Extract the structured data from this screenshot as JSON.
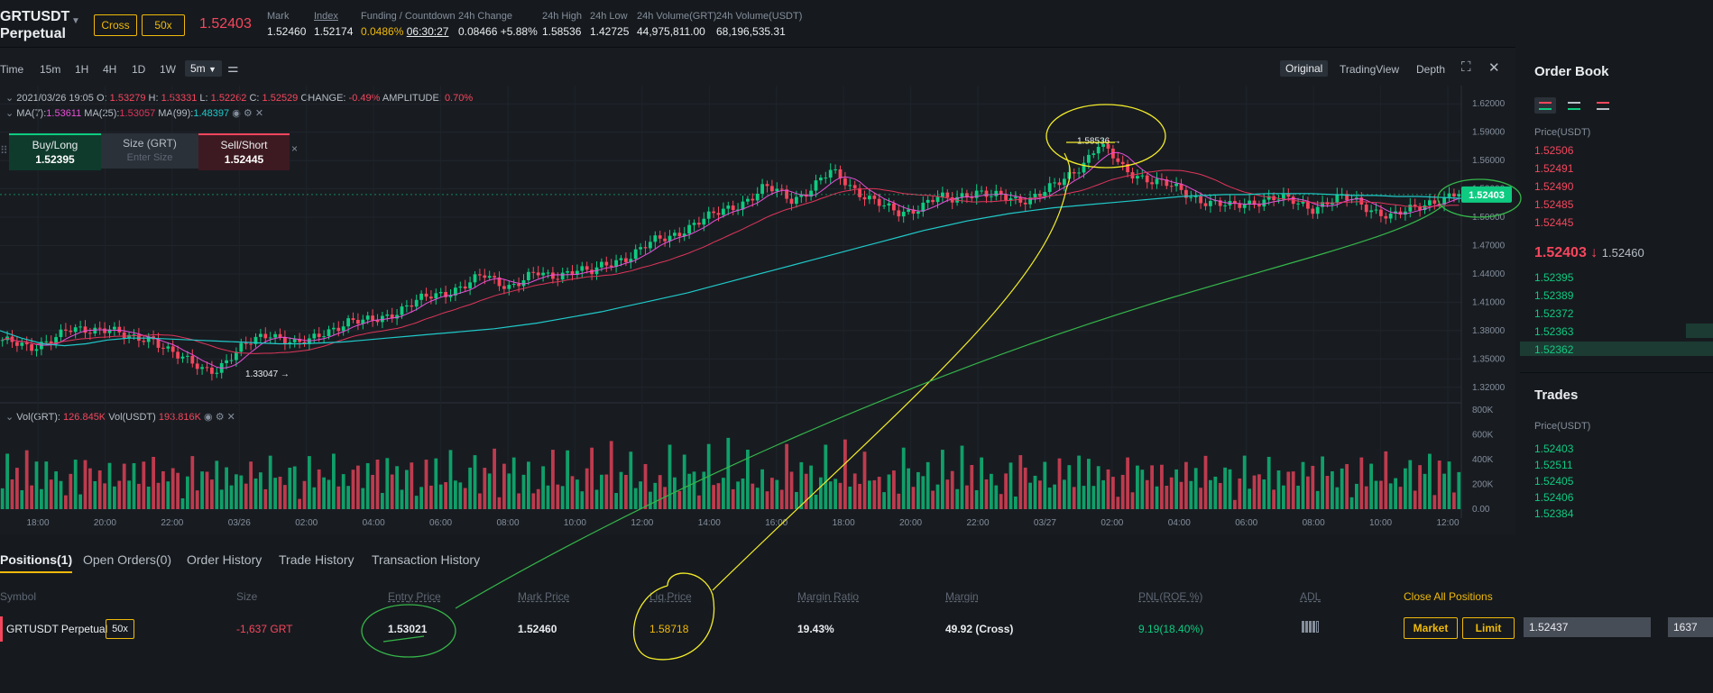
{
  "header": {
    "symbol_line1": "GRTUSDT",
    "symbol_line2": "Perpetual",
    "margin_mode": "Cross",
    "leverage": "50x",
    "last_price": "1.52403",
    "stats": [
      {
        "label": "Mark",
        "value": "1.52460"
      },
      {
        "label": "Index",
        "value": "1.52174"
      },
      {
        "label": "Funding / Countdown",
        "value_a": "0.0486%",
        "value_b": "06:30:27"
      },
      {
        "label": "24h Change",
        "value": "0.08466 +5.88%"
      },
      {
        "label": "24h High",
        "value": "1.58536"
      },
      {
        "label": "24h Low",
        "value": "1.42725"
      },
      {
        "label": "24h Volume(GRT)",
        "value": "44,975,811.00"
      },
      {
        "label": "24h Volume(USDT)",
        "value": "68,196,535.31"
      }
    ]
  },
  "toolbar": {
    "intervals": [
      "Time",
      "15m",
      "1H",
      "4H",
      "1D",
      "1W"
    ],
    "active_interval": "5m",
    "views": [
      "Original",
      "TradingView",
      "Depth"
    ],
    "active_view": "Original"
  },
  "legend": {
    "ohlc_date": "2021/03/26 19:05",
    "o_label": "O:",
    "o": "1.53279",
    "h_label": "H:",
    "h": "1.53331",
    "l_label": "L:",
    "l": "1.52262",
    "c_label": "C:",
    "c": "1.52529",
    "change_label": "CHANGE:",
    "change": "-0.49%",
    "amplitude_label": "AMPLITUDE:",
    "amplitude": "0.70%",
    "ma7_label": "MA(7):",
    "ma7": "1.53611",
    "ma25_label": "MA(25):",
    "ma25": "1.53057",
    "ma99_label": "MA(99):",
    "ma99": "1.48397",
    "vol_grt_label": "Vol(GRT):",
    "vol_grt": "126.845K",
    "vol_usdt_label": "Vol(USDT)",
    "vol_usdt": "193.816K"
  },
  "trade_widget": {
    "buy_label": "Buy/Long",
    "buy_price": "1.52395",
    "size_label": "Size (GRT)",
    "size_placeholder": "Enter Size",
    "sell_label": "Sell/Short",
    "sell_price": "1.52445",
    "close": "×"
  },
  "chart_data": {
    "type": "candlestick",
    "y_ticks": [
      "1.62000",
      "1.59000",
      "1.56000",
      "1.53000",
      "1.50000",
      "1.47000",
      "1.44000",
      "1.41000",
      "1.38000",
      "1.35000",
      "1.32000"
    ],
    "vol_ticks": [
      "800K",
      "600K",
      "400K",
      "200K",
      "0.00"
    ],
    "x_ticks": [
      "18:00",
      "20:00",
      "22:00",
      "03/26",
      "02:00",
      "04:00",
      "06:00",
      "08:00",
      "10:00",
      "12:00",
      "14:00",
      "16:00",
      "18:00",
      "20:00",
      "22:00",
      "03/27",
      "02:00",
      "04:00",
      "06:00",
      "08:00",
      "10:00",
      "12:00"
    ],
    "y_range": [
      1.315,
      1.625
    ],
    "high_label": "1.58536",
    "low_label": "1.33047",
    "current_price_tag": "1.52403",
    "close_path": [
      1.37,
      1.365,
      1.36,
      1.368,
      1.375,
      1.38,
      1.378,
      1.382,
      1.385,
      1.375,
      1.368,
      1.372,
      1.366,
      1.355,
      1.345,
      1.338,
      1.34,
      1.352,
      1.362,
      1.37,
      1.378,
      1.373,
      1.365,
      1.368,
      1.378,
      1.385,
      1.39,
      1.388,
      1.392,
      1.398,
      1.404,
      1.41,
      1.416,
      1.42,
      1.425,
      1.43,
      1.438,
      1.432,
      1.428,
      1.434,
      1.44,
      1.436,
      1.442,
      1.446,
      1.44,
      1.448,
      1.455,
      1.46,
      1.468,
      1.475,
      1.48,
      1.488,
      1.494,
      1.5,
      1.508,
      1.514,
      1.52,
      1.53,
      1.528,
      1.52,
      1.525,
      1.535,
      1.548,
      1.54,
      1.528,
      1.518,
      1.51,
      1.505,
      1.508,
      1.514,
      1.52,
      1.518,
      1.525,
      1.528,
      1.522,
      1.52,
      1.518,
      1.522,
      1.528,
      1.534,
      1.545,
      1.56,
      1.578,
      1.565,
      1.548,
      1.545,
      1.54,
      1.535,
      1.528,
      1.522,
      1.518,
      1.514,
      1.51,
      1.514,
      1.518,
      1.521,
      1.518,
      1.514,
      1.51,
      1.516,
      1.52,
      1.518,
      1.512,
      1.506,
      1.5,
      1.505,
      1.512,
      1.518,
      1.52,
      1.524
    ],
    "ma99_path": [
      1.38,
      1.372,
      1.366,
      1.364,
      1.366,
      1.37,
      1.372,
      1.372,
      1.371,
      1.37,
      1.369,
      1.368,
      1.367,
      1.366,
      1.366,
      1.367,
      1.368,
      1.37,
      1.372,
      1.374,
      1.376,
      1.378,
      1.38,
      1.382,
      1.385,
      1.388,
      1.392,
      1.396,
      1.4,
      1.405,
      1.41,
      1.415,
      1.42,
      1.426,
      1.432,
      1.438,
      1.444,
      1.45,
      1.456,
      1.462,
      1.468,
      1.474,
      1.48,
      1.486,
      1.491,
      1.496,
      1.5,
      1.504,
      1.507,
      1.51,
      1.512,
      1.514,
      1.516,
      1.518,
      1.52,
      1.522,
      1.523,
      1.524,
      1.524,
      1.525,
      1.525,
      1.525,
      1.524,
      1.523,
      1.523,
      1.522,
      1.522,
      1.521,
      1.52
    ],
    "vol_pattern": [
      0.35,
      0.55,
      0.25,
      0.4,
      0.3,
      0.6,
      0.2,
      0.45,
      0.3,
      0.5,
      0.25,
      0.35,
      0.4,
      0.15,
      0.3,
      0.45,
      0.2,
      0.55,
      0.35,
      0.25,
      0.5,
      0.3,
      0.4,
      0.2
    ]
  },
  "order_book": {
    "title": "Order Book",
    "price_header": "Price(USDT)",
    "asks": [
      "1.52506",
      "1.52491",
      "1.52490",
      "1.52485",
      "1.52445"
    ],
    "last": "1.52403",
    "last_arrow": "↓",
    "mark": "1.52460",
    "bids": [
      "1.52395",
      "1.52389",
      "1.52372",
      "1.52363",
      "1.52362"
    ]
  },
  "trades": {
    "title": "Trades",
    "price_header": "Price(USDT)",
    "rows": [
      "1.52403",
      "1.52511",
      "1.52405",
      "1.52406",
      "1.52384"
    ]
  },
  "positions": {
    "tabs": [
      "Positions(1)",
      "Open Orders(0)",
      "Order History",
      "Trade History",
      "Transaction History"
    ],
    "columns": [
      "Symbol",
      "Size",
      "Entry Price",
      "Mark Price",
      "Liq.Price",
      "Margin Ratio",
      "Margin",
      "PNL(ROE %)",
      "ADL"
    ],
    "close_all": "Close All Positions",
    "row": {
      "symbol": "GRTUSDT Perpetual",
      "leverage": "50x",
      "size": "-1,637 GRT",
      "entry_price": "1.53021",
      "mark_price": "1.52460",
      "liq_price": "1.58718",
      "margin_ratio": "19.43%",
      "margin": "49.92 (Cross)",
      "pnl": "9.19(18.40%)",
      "market_btn": "Market",
      "limit_btn": "Limit",
      "price_input": "1.52437",
      "qty_input": "1637"
    }
  },
  "colors": {
    "up": "#0ecb81",
    "down": "#f6465d",
    "accent": "#f0b90b",
    "ma7": "#e84fd8",
    "ma25": "#e0355a",
    "ma99": "#20c9c9",
    "annotation_yellow": "#f4ec2a",
    "annotation_green": "#36b64a"
  }
}
